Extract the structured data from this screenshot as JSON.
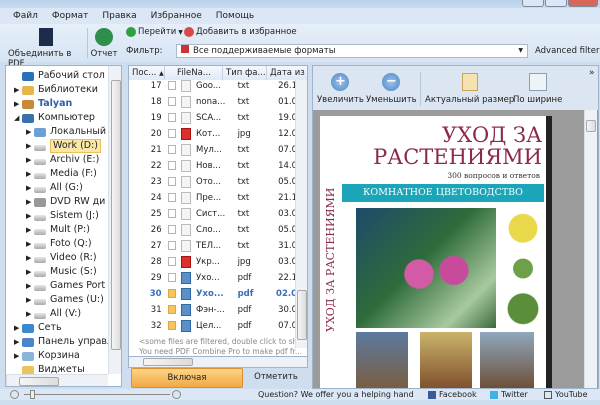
{
  "menu": [
    "Файл",
    "Формат",
    "Правка",
    "Избранное",
    "Помощь"
  ],
  "toolbar": {
    "combine": "Объединить в PDF",
    "report": "Отчет",
    "goto": "Перейти",
    "favorite": "Добавить в избранное",
    "filter_label": "Фильтр:",
    "filter_value": "Все поддерживаемые форматы",
    "advanced_filter": "Advanced filter"
  },
  "tree": [
    {
      "label": "Рабочий стол",
      "level": 0,
      "arrow": "",
      "icon": "desktop"
    },
    {
      "label": "Библиотеки",
      "level": 0,
      "arrow": "▶",
      "icon": "libraries"
    },
    {
      "label": "Talyan",
      "level": 0,
      "arrow": "▶",
      "icon": "user"
    },
    {
      "label": "Компьютер",
      "level": 0,
      "arrow": "◢",
      "icon": "computer"
    },
    {
      "label": "Локальный",
      "level": 1,
      "arrow": "▶",
      "icon": "system-drive"
    },
    {
      "label": "Work (D:)",
      "level": 1,
      "arrow": "▶",
      "icon": "drive",
      "selected": true
    },
    {
      "label": "Archiv (E:)",
      "level": 1,
      "arrow": "▶",
      "icon": "drive"
    },
    {
      "label": "Media (F:)",
      "level": 1,
      "arrow": "▶",
      "icon": "drive"
    },
    {
      "label": "All (G:)",
      "level": 1,
      "arrow": "▶",
      "icon": "drive"
    },
    {
      "label": "DVD RW ди",
      "level": 1,
      "arrow": "▶",
      "icon": "dvd"
    },
    {
      "label": "Sistem (J:)",
      "level": 1,
      "arrow": "▶",
      "icon": "drive"
    },
    {
      "label": "Mult (P:)",
      "level": 1,
      "arrow": "▶",
      "icon": "drive"
    },
    {
      "label": "Foto (Q:)",
      "level": 1,
      "arrow": "▶",
      "icon": "drive"
    },
    {
      "label": "Video (R:)",
      "level": 1,
      "arrow": "▶",
      "icon": "drive"
    },
    {
      "label": "Music (S:)",
      "level": 1,
      "arrow": "▶",
      "icon": "drive"
    },
    {
      "label": "Games Port",
      "level": 1,
      "arrow": "▶",
      "icon": "drive"
    },
    {
      "label": "Games (U:)",
      "level": 1,
      "arrow": "▶",
      "icon": "drive"
    },
    {
      "label": "All (V:)",
      "level": 1,
      "arrow": "▶",
      "icon": "drive"
    },
    {
      "label": "Сеть",
      "level": 0,
      "arrow": "▶",
      "icon": "network"
    },
    {
      "label": "Панель управл",
      "level": 0,
      "arrow": "▶",
      "icon": "control-panel"
    },
    {
      "label": "Корзина",
      "level": 0,
      "arrow": "▶",
      "icon": "recycle-bin"
    },
    {
      "label": "Виджеты",
      "level": 0,
      "arrow": "",
      "icon": "folder"
    }
  ],
  "filelist": {
    "columns": [
      "Пос...",
      "FileNa...",
      "Тип фа...",
      "Дата из"
    ],
    "rows": [
      {
        "n": "17",
        "name": "Goo...",
        "type": "txt",
        "date": "26.1",
        "checked": false
      },
      {
        "n": "18",
        "name": "nona...",
        "type": "txt",
        "date": "01.0",
        "checked": false
      },
      {
        "n": "19",
        "name": "SCA...",
        "type": "txt",
        "date": "19.0",
        "checked": false
      },
      {
        "n": "20",
        "name": "Кот...",
        "type": "jpg",
        "date": "12.0",
        "checked": false
      },
      {
        "n": "21",
        "name": "Мул...",
        "type": "txt",
        "date": "07.0",
        "checked": false
      },
      {
        "n": "22",
        "name": "Нов...",
        "type": "txt",
        "date": "14.0",
        "checked": false
      },
      {
        "n": "23",
        "name": "Ото...",
        "type": "txt",
        "date": "05.0",
        "checked": false
      },
      {
        "n": "24",
        "name": "Пре...",
        "type": "txt",
        "date": "21.1",
        "checked": false
      },
      {
        "n": "25",
        "name": "Сист...",
        "type": "txt",
        "date": "03.0",
        "checked": false
      },
      {
        "n": "26",
        "name": "Сло...",
        "type": "txt",
        "date": "05.0",
        "checked": false
      },
      {
        "n": "27",
        "name": "ТЕЛ...",
        "type": "txt",
        "date": "31.0",
        "checked": false
      },
      {
        "n": "28",
        "name": "Укр...",
        "type": "jpg",
        "date": "03.0",
        "checked": false
      },
      {
        "n": "29",
        "name": "Ухо...",
        "type": "pdf",
        "date": "22.1",
        "checked": false
      },
      {
        "n": "30",
        "name": "Ухо...",
        "type": "pdf",
        "date": "02.0",
        "checked": true,
        "selected": true
      },
      {
        "n": "31",
        "name": "Фэн-...",
        "type": "pdf",
        "date": "30.0",
        "checked": true
      },
      {
        "n": "32",
        "name": "Цел...",
        "type": "pdf",
        "date": "07.0",
        "checked": true
      }
    ],
    "note1": "<some files are filtered, double click to show",
    "note2": "You need PDF Combine Pro to make pdf fr...",
    "include_subdirs": "Включая поддиректории",
    "mark": "Отметить"
  },
  "preview": {
    "zoom_in": "Увеличить",
    "zoom_out": "Уменьшить",
    "actual_size": "Актуальный размер",
    "fit_width": "По ширине",
    "book": {
      "title1": "УХОД ЗА",
      "title2": "РАСТЕНИЯМИ",
      "subtitle": "300 вопросов и ответов",
      "band": "КОМНАТНОЕ ЦВЕТОВОДСТВО",
      "spine": "УХОД ЗА РАСТЕНИЯМИ"
    }
  },
  "status": {
    "question": "Question? We offer you a helping hand",
    "facebook": "Facebook",
    "twitter": "Twitter",
    "youtube": "YouTube"
  },
  "colors": {
    "accent": "#f6b64a",
    "selected_text": "#3b6fb6",
    "band": "#1aa6b8",
    "title": "#8b2a4a"
  }
}
